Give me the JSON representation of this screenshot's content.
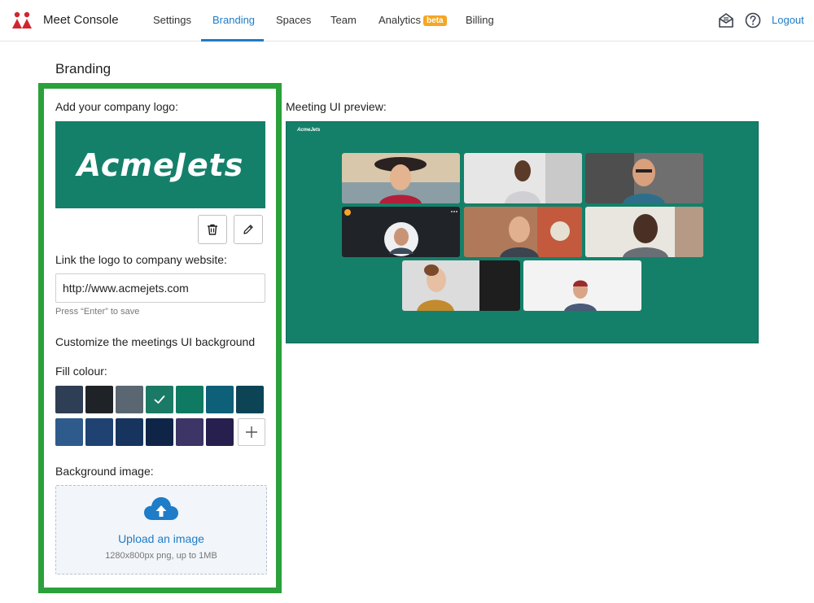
{
  "app": {
    "title": "Meet Console"
  },
  "nav": {
    "settings": "Settings",
    "branding": "Branding",
    "spaces": "Spaces",
    "team": "Team",
    "analytics": "Analytics",
    "analytics_badge": "beta",
    "billing": "Billing",
    "logout": "Logout"
  },
  "icons": {
    "inbox": "envelope-open-icon",
    "help": "question-circle-icon",
    "trash": "trash-icon",
    "edit": "pencil-icon",
    "add": "plus-icon",
    "upload": "cloud-upload-icon",
    "check": "check-icon"
  },
  "page": {
    "title": "Branding"
  },
  "branding": {
    "logo_label": "Add your company logo:",
    "logo_text": "AcmeJets",
    "link_label": "Link the logo to company website:",
    "link_value": "http://www.acmejets.com",
    "link_hint": "Press “Enter” to save",
    "customize_heading": "Customize the meetings UI background",
    "fill_label": "Fill colour:",
    "swatches": [
      "#2d3e55",
      "#1f2328",
      "#5a6672",
      "#1a7a66",
      "#0f7a62",
      "#0e6079",
      "#0c4456",
      "#2e5b8c",
      "#1f4272",
      "#17345e",
      "#0f2548",
      "#3c3566",
      "#271f4d"
    ],
    "selected_swatch": "#1a7a66",
    "bg_image_label": "Background image:",
    "upload_label": "Upload an image",
    "upload_hint": "1280x800px png, up to 1MB"
  },
  "preview": {
    "label": "Meeting UI preview:",
    "logo_text": "AcmeJets",
    "background": "#14806a"
  },
  "colors": {
    "accent": "#1e7cc8",
    "highlight_border": "#2aa13a",
    "logo_bg": "#14806a",
    "brand_red": "#d0262d",
    "beta": "#f5a623"
  }
}
